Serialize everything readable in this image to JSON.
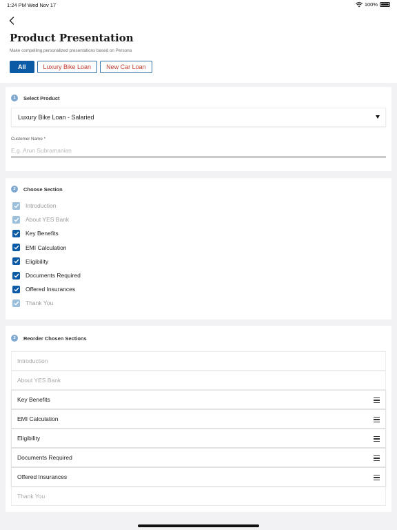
{
  "status_bar": {
    "time": "1:24 PM",
    "date": "Wed Nov 17",
    "battery": "100%"
  },
  "header": {
    "title": "Product Presentation",
    "subtitle": "Make compelling personalized presentations based on Persona",
    "filters": [
      {
        "label": "All",
        "active": true
      },
      {
        "label": "Luxury Bike Loan",
        "active": false
      },
      {
        "label": "New Car Loan",
        "active": false
      }
    ]
  },
  "select_product": {
    "step": "1",
    "title": "Select Product",
    "selected_value": "Luxury Bike Loan - Salaried",
    "customer_name_label": "Customer Name *",
    "customer_name_placeholder": "E.g. Arun Subramanian",
    "customer_name_value": ""
  },
  "choose_section": {
    "step": "2",
    "title": "Choose Section",
    "items": [
      {
        "label": "Introduction",
        "checked": true,
        "disabled": true
      },
      {
        "label": "About YES Bank",
        "checked": true,
        "disabled": true
      },
      {
        "label": "Key Benefits",
        "checked": true,
        "disabled": false
      },
      {
        "label": "EMI Calculation",
        "checked": true,
        "disabled": false
      },
      {
        "label": "Eligibility",
        "checked": true,
        "disabled": false
      },
      {
        "label": "Documents Required",
        "checked": true,
        "disabled": false
      },
      {
        "label": "Offered Insurances",
        "checked": true,
        "disabled": false
      },
      {
        "label": "Thank You",
        "checked": true,
        "disabled": true
      }
    ]
  },
  "reorder_sections": {
    "step": "3",
    "title": "Reorder Chosen Sections",
    "items": [
      {
        "label": "Introduction",
        "draggable": false
      },
      {
        "label": "About YES Bank",
        "draggable": false
      },
      {
        "label": "Key Benefits",
        "draggable": true
      },
      {
        "label": "EMI Calculation",
        "draggable": true
      },
      {
        "label": "Eligibility",
        "draggable": true
      },
      {
        "label": "Documents Required",
        "draggable": true
      },
      {
        "label": "Offered Insurances",
        "draggable": true
      },
      {
        "label": "Thank You",
        "draggable": false
      }
    ]
  },
  "colors": {
    "primary": "#0b5aa5",
    "chip_text": "#c0392b",
    "disabled_check": "#9cbfdc"
  },
  "icons": {
    "back": "chevron-left-icon",
    "wifi": "wifi-icon",
    "battery": "battery-icon",
    "dropdown": "caret-down-icon",
    "drag": "drag-handle-icon",
    "check": "checkmark-icon"
  }
}
